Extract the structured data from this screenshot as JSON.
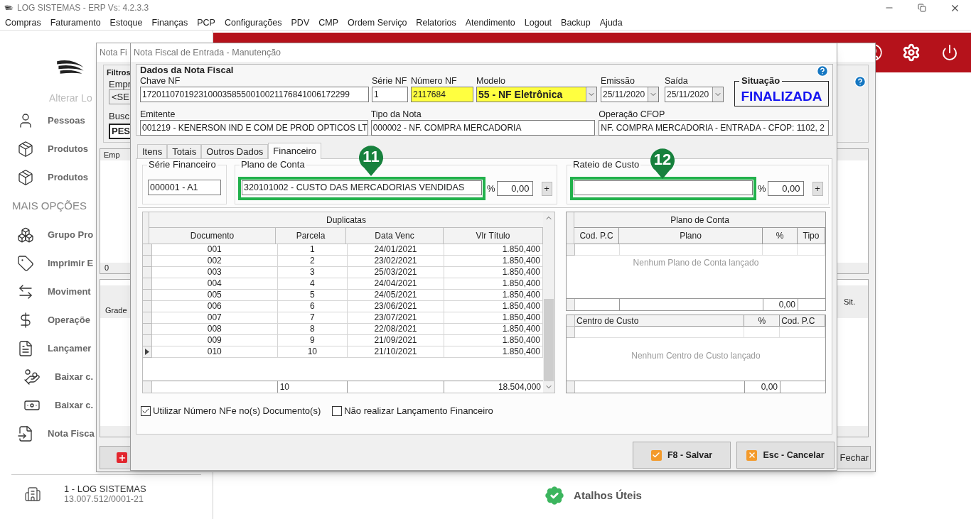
{
  "window": {
    "title": "LOG SISTEMAS - ERP Vs: 4.2.3.3"
  },
  "menu": [
    "Compras",
    "Faturamento",
    "Estoque",
    "Finanças",
    "PCP",
    "Configurações",
    "PDV",
    "CMP",
    "Ordem Serviço",
    "Relatorios",
    "Atendimento",
    "Logout",
    "Backup",
    "Ajuda"
  ],
  "sidebar": {
    "link": "Alterar Lo",
    "items": [
      {
        "label": "Pessoas",
        "kind": "item"
      },
      {
        "label": "Produtos",
        "kind": "item"
      },
      {
        "label": "Produtos",
        "kind": "item"
      },
      {
        "label": "MAIS OPÇÕES",
        "kind": "section"
      },
      {
        "label": "Grupo Pro",
        "kind": "item"
      },
      {
        "label": "Imprimir E",
        "kind": "item"
      },
      {
        "label": "Moviment",
        "kind": "item"
      },
      {
        "label": "Operaçõe",
        "kind": "item"
      },
      {
        "label": "Lançamer",
        "kind": "item"
      },
      {
        "label": "Baixar c.",
        "kind": "subitem"
      },
      {
        "label": "Baixar c.",
        "kind": "subitem"
      },
      {
        "label": "Nota Fisca",
        "kind": "item"
      }
    ]
  },
  "company": {
    "name": "1 - LOG SISTEMAS",
    "cnpj": "13.007.512/0001-21"
  },
  "shortcuts": {
    "label": "Atalhos Úteis"
  },
  "back_window": {
    "title": "Nota Fi",
    "filter_title": "Filtros",
    "empresa_label": "Empr",
    "empresa_value": "<SE",
    "busca_label": "Busc",
    "busca_value": "PES",
    "grid_column": "Emp",
    "grid_count": "0",
    "grade_label": "Grade",
    "status_column": "Sit.",
    "close_button": "Fechar"
  },
  "dialog": {
    "title": "Nota Fiscal de Entrada - Manutenção",
    "header": {
      "title": "Dados da Nota Fiscal",
      "row1": [
        {
          "label": "Chave NF",
          "value": "17201107019231000358550010021176841006172299",
          "kind": "text",
          "highlighted": false
        },
        {
          "label": "Série NF",
          "value": "1",
          "kind": "text",
          "highlighted": false
        },
        {
          "label": "Número NF",
          "value": "2117684",
          "kind": "text",
          "highlighted": true
        },
        {
          "label": "Modelo",
          "value": "55 - NF Eletrônica",
          "kind": "combo",
          "highlighted": true
        },
        {
          "label": "Emissão",
          "value": "25/11/2020",
          "kind": "date",
          "highlighted": false
        },
        {
          "label": "Saída",
          "value": "25/11/2020",
          "kind": "date",
          "highlighted": false
        }
      ],
      "situacao": {
        "label": "Situação",
        "value": "FINALIZADA"
      },
      "row2": [
        {
          "label": "Emitente",
          "value": "001219 - KENERSON IND E COM DE PROD OPTICOS LT",
          "kind": "text",
          "highlighted": false
        },
        {
          "label": "Tipo da Nota",
          "value": "000002 - NF. COMPRA MERCADORIA",
          "kind": "text",
          "highlighted": false
        },
        {
          "label": "Operação CFOP",
          "value": "NF. COMPRA MERCADORIA - ENTRADA - CFOP: 1102, 2",
          "kind": "text",
          "highlighted": false
        }
      ]
    },
    "tabs": [
      {
        "label": "Itens",
        "selected": false
      },
      {
        "label": "Totais",
        "selected": false
      },
      {
        "label": "Outros Dados",
        "selected": false
      },
      {
        "label": "Financeiro",
        "selected": true
      }
    ],
    "financeiro": {
      "serie": {
        "label": "Série Financeiro",
        "value": "000001 - A1"
      },
      "plano": {
        "label": "Plano de Conta",
        "value": "320101002 - CUSTO DAS MERCADORIAS VENDIDAS",
        "percent_sign": "%",
        "percent": "0,00",
        "add": "+",
        "highlighted": true
      },
      "rateio": {
        "label": "Rateio de Custo",
        "percent_sign": "%",
        "percent": "0,00",
        "add": "+",
        "highlighted": true
      }
    },
    "duplicatas": {
      "title": "Duplicatas",
      "columns": [
        "Documento",
        "Parcela",
        "Data Venc",
        "Vlr Título"
      ],
      "rows": [
        {
          "cells": [
            "001",
            "1",
            "24/01/2021",
            "1.850,400"
          ],
          "current": false
        },
        {
          "cells": [
            "002",
            "2",
            "23/02/2021",
            "1.850,400"
          ],
          "current": false
        },
        {
          "cells": [
            "003",
            "3",
            "25/03/2021",
            "1.850,400"
          ],
          "current": false
        },
        {
          "cells": [
            "004",
            "4",
            "24/04/2021",
            "1.850,400"
          ],
          "current": false
        },
        {
          "cells": [
            "005",
            "5",
            "24/05/2021",
            "1.850,400"
          ],
          "current": false
        },
        {
          "cells": [
            "006",
            "6",
            "23/06/2021",
            "1.850,400"
          ],
          "current": false
        },
        {
          "cells": [
            "007",
            "7",
            "23/07/2021",
            "1.850,400"
          ],
          "current": false
        },
        {
          "cells": [
            "008",
            "8",
            "22/08/2021",
            "1.850,400"
          ],
          "current": false
        },
        {
          "cells": [
            "009",
            "9",
            "21/09/2021",
            "1.850,400"
          ],
          "current": false
        },
        {
          "cells": [
            "010",
            "10",
            "21/10/2021",
            "1.850,400"
          ],
          "current": true
        }
      ],
      "count": "10",
      "total": "18.504,000"
    },
    "plano_grid": {
      "title": "Plano de Conta",
      "columns": [
        "Cod. P.C",
        "Plano",
        "%",
        "Tipo"
      ],
      "empty_message": "Nenhum Plano de Conta lançado",
      "total": "0,00"
    },
    "centro_grid": {
      "columns": [
        "Centro de Custo",
        "%",
        "Cod. P.C"
      ],
      "empty_message": "Nenhum Centro de Custo lançado",
      "total": "0,00"
    },
    "options": [
      {
        "label": "Utilizar Número NFe no(s) Documento(s)",
        "checked": true
      },
      {
        "label": "Não realizar Lançamento Financeiro",
        "checked": false
      }
    ],
    "buttons": [
      {
        "label": "F8 - Salvar",
        "kind": "confirm"
      },
      {
        "label": "Esc - Cancelar",
        "kind": "cancel"
      }
    ]
  },
  "annotations": [
    {
      "label": "11"
    },
    {
      "label": "12"
    }
  ]
}
